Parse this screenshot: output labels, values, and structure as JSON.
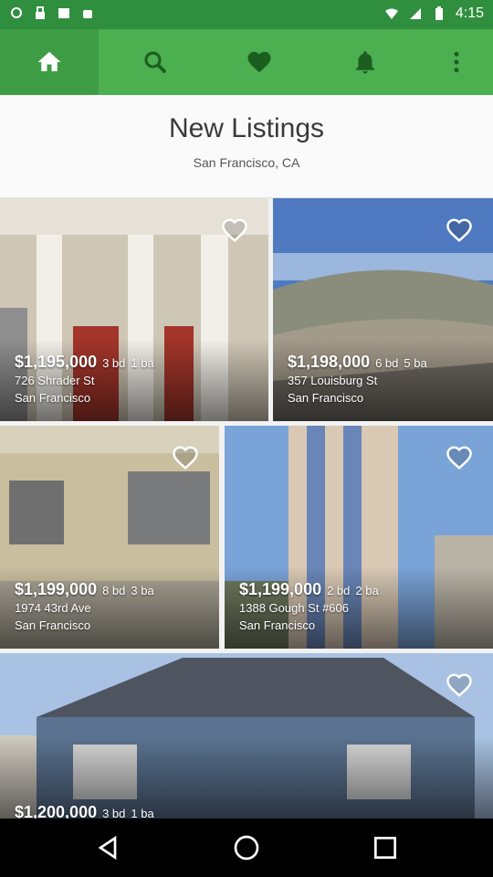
{
  "status_bar": {
    "time": "4:15"
  },
  "toolbar": {
    "items": [
      {
        "name": "home",
        "icon": "home-icon"
      },
      {
        "name": "search",
        "icon": "search-icon"
      },
      {
        "name": "favorites",
        "icon": "heart-icon"
      },
      {
        "name": "notifications",
        "icon": "bell-icon"
      },
      {
        "name": "more",
        "icon": "more-vert-icon"
      }
    ]
  },
  "header": {
    "title": "New Listings",
    "location": "San Francisco, CA"
  },
  "listings": [
    {
      "price": "$1,195,000",
      "beds": "3 bd",
      "baths": "1 ba",
      "address": "726 Shrader St",
      "city": "San Francisco"
    },
    {
      "price": "$1,198,000",
      "beds": "6 bd",
      "baths": "5 ba",
      "address": "357 Louisburg St",
      "city": "San Francisco"
    },
    {
      "price": "$1,199,000",
      "beds": "8 bd",
      "baths": "3 ba",
      "address": "1974 43rd Ave",
      "city": "San Francisco"
    },
    {
      "price": "$1,199,000",
      "beds": "2 bd",
      "baths": "2 ba",
      "address": "1388 Gough St #606",
      "city": "San Francisco"
    },
    {
      "price": "$1,200,000",
      "beds": "3 bd",
      "baths": "1 ba",
      "address": "",
      "city": ""
    }
  ],
  "colors": {
    "toolbar": "#4caf50",
    "status_bar": "#2f8f3e",
    "icon_active": "#ffffff",
    "icon_inactive": "#1b5e20"
  }
}
